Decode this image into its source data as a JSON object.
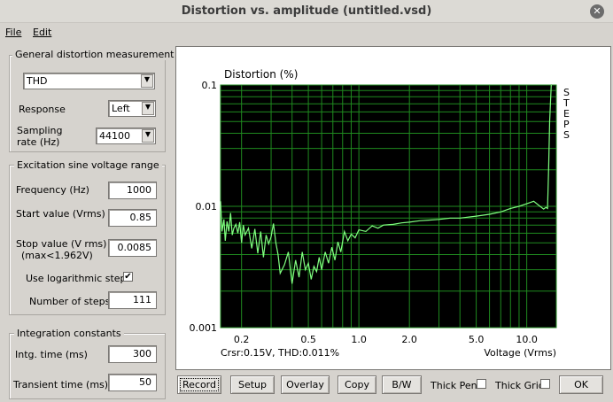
{
  "window": {
    "title": "Distortion vs. amplitude (untitled.vsd)",
    "close_glyph": "✕"
  },
  "menu": {
    "file": "File",
    "edit": "Edit"
  },
  "general": {
    "title": "General distortion measurement",
    "measure_value": "THD",
    "response_label": "Response",
    "response_value": "Left",
    "sampling_label_1": "Sampling",
    "sampling_label_2": "rate (Hz)",
    "sampling_value": "44100"
  },
  "excitation": {
    "title": "Excitation sine voltage range",
    "frequency_label": "Frequency (Hz)",
    "frequency_value": "1000",
    "start_label": "Start value (Vrms)",
    "start_value": "0.85",
    "stop_label_1": "Stop value (V rms)",
    "stop_label_2": "(max<1.962V)",
    "stop_value": "0.0085",
    "log_label": "Use logarithmic steps",
    "log_checked_glyph": "✔",
    "steps_label": "Number of steps",
    "steps_value": "111"
  },
  "integration": {
    "title": "Integration constants",
    "intg_label": "Intg. time (ms)",
    "intg_value": "300",
    "transient_label": "Transient time (ms)",
    "transient_value": "50"
  },
  "toolbar": {
    "record": "Record",
    "setup": "Setup",
    "overlay": "Overlay",
    "copy": "Copy",
    "bw": "B/W",
    "thick_pen": "Thick Pen",
    "thick_grid": "Thick Grid",
    "ok": "OK"
  },
  "colors": {
    "plot_bg": "#000000",
    "grid": "#1f8a1f",
    "trace": "#80ff80",
    "panel_bg": "#ffffff"
  },
  "chart_data": {
    "type": "line",
    "title": "Distortion (%)",
    "xlabel": "Voltage (Vrms)",
    "ylabel": "",
    "x_scale": "log",
    "y_scale": "log",
    "xlim": [
      0.15,
      15
    ],
    "ylim": [
      0.001,
      0.1
    ],
    "x_ticks": [
      0.2,
      0.5,
      1.0,
      2.0,
      5.0,
      10.0
    ],
    "x_tick_labels": [
      "0.2",
      "0.5",
      "1.0",
      "2.0",
      "5.0",
      "10.0"
    ],
    "y_ticks": [
      0.1,
      0.01,
      0.001
    ],
    "y_tick_labels": [
      "0.1",
      "0.01",
      "0.001"
    ],
    "grid": true,
    "side_label": "STEPS",
    "cursor_text": "Crsr:0.15V, THD:0.011%",
    "series": [
      {
        "x": [
          0.15,
          0.153,
          0.157,
          0.16,
          0.164,
          0.168,
          0.172,
          0.176,
          0.18,
          0.185,
          0.19,
          0.195,
          0.2,
          0.205,
          0.21,
          0.22,
          0.23,
          0.24,
          0.25,
          0.26,
          0.27,
          0.28,
          0.29,
          0.3,
          0.31,
          0.32,
          0.33,
          0.34,
          0.36,
          0.38,
          0.4,
          0.42,
          0.44,
          0.46,
          0.48,
          0.5,
          0.52,
          0.54,
          0.56,
          0.58,
          0.6,
          0.63,
          0.66,
          0.69,
          0.72,
          0.75,
          0.78,
          0.82,
          0.86,
          0.9,
          0.95,
          1.0,
          1.1,
          1.2,
          1.3,
          1.4,
          1.6,
          1.8,
          2.0,
          2.3,
          2.6,
          3.0,
          3.5,
          4.0,
          5.0,
          6.0,
          7.0,
          8.0,
          9.0,
          10.0,
          11.0,
          12.0,
          12.6,
          13.0,
          13.3,
          13.5,
          13.7,
          13.9,
          14.0
        ],
        "y": [
          0.011,
          0.0062,
          0.0078,
          0.0052,
          0.0075,
          0.0062,
          0.0088,
          0.0058,
          0.0066,
          0.0071,
          0.006,
          0.0074,
          0.005,
          0.007,
          0.0058,
          0.0066,
          0.0045,
          0.0065,
          0.0041,
          0.0062,
          0.0038,
          0.0058,
          0.0049,
          0.0056,
          0.0072,
          0.005,
          0.004,
          0.0028,
          0.0033,
          0.0042,
          0.0023,
          0.0036,
          0.0026,
          0.0042,
          0.003,
          0.0034,
          0.0025,
          0.0032,
          0.0029,
          0.0038,
          0.003,
          0.0042,
          0.0034,
          0.0046,
          0.0036,
          0.0051,
          0.0042,
          0.0062,
          0.0052,
          0.0059,
          0.0055,
          0.0064,
          0.0062,
          0.0069,
          0.0066,
          0.007,
          0.0071,
          0.0073,
          0.0074,
          0.0076,
          0.0077,
          0.0078,
          0.008,
          0.008,
          0.0083,
          0.0086,
          0.009,
          0.0096,
          0.01,
          0.0105,
          0.011,
          0.01,
          0.0095,
          0.0098,
          0.0096,
          0.02,
          0.05,
          0.08,
          0.1
        ]
      }
    ]
  }
}
